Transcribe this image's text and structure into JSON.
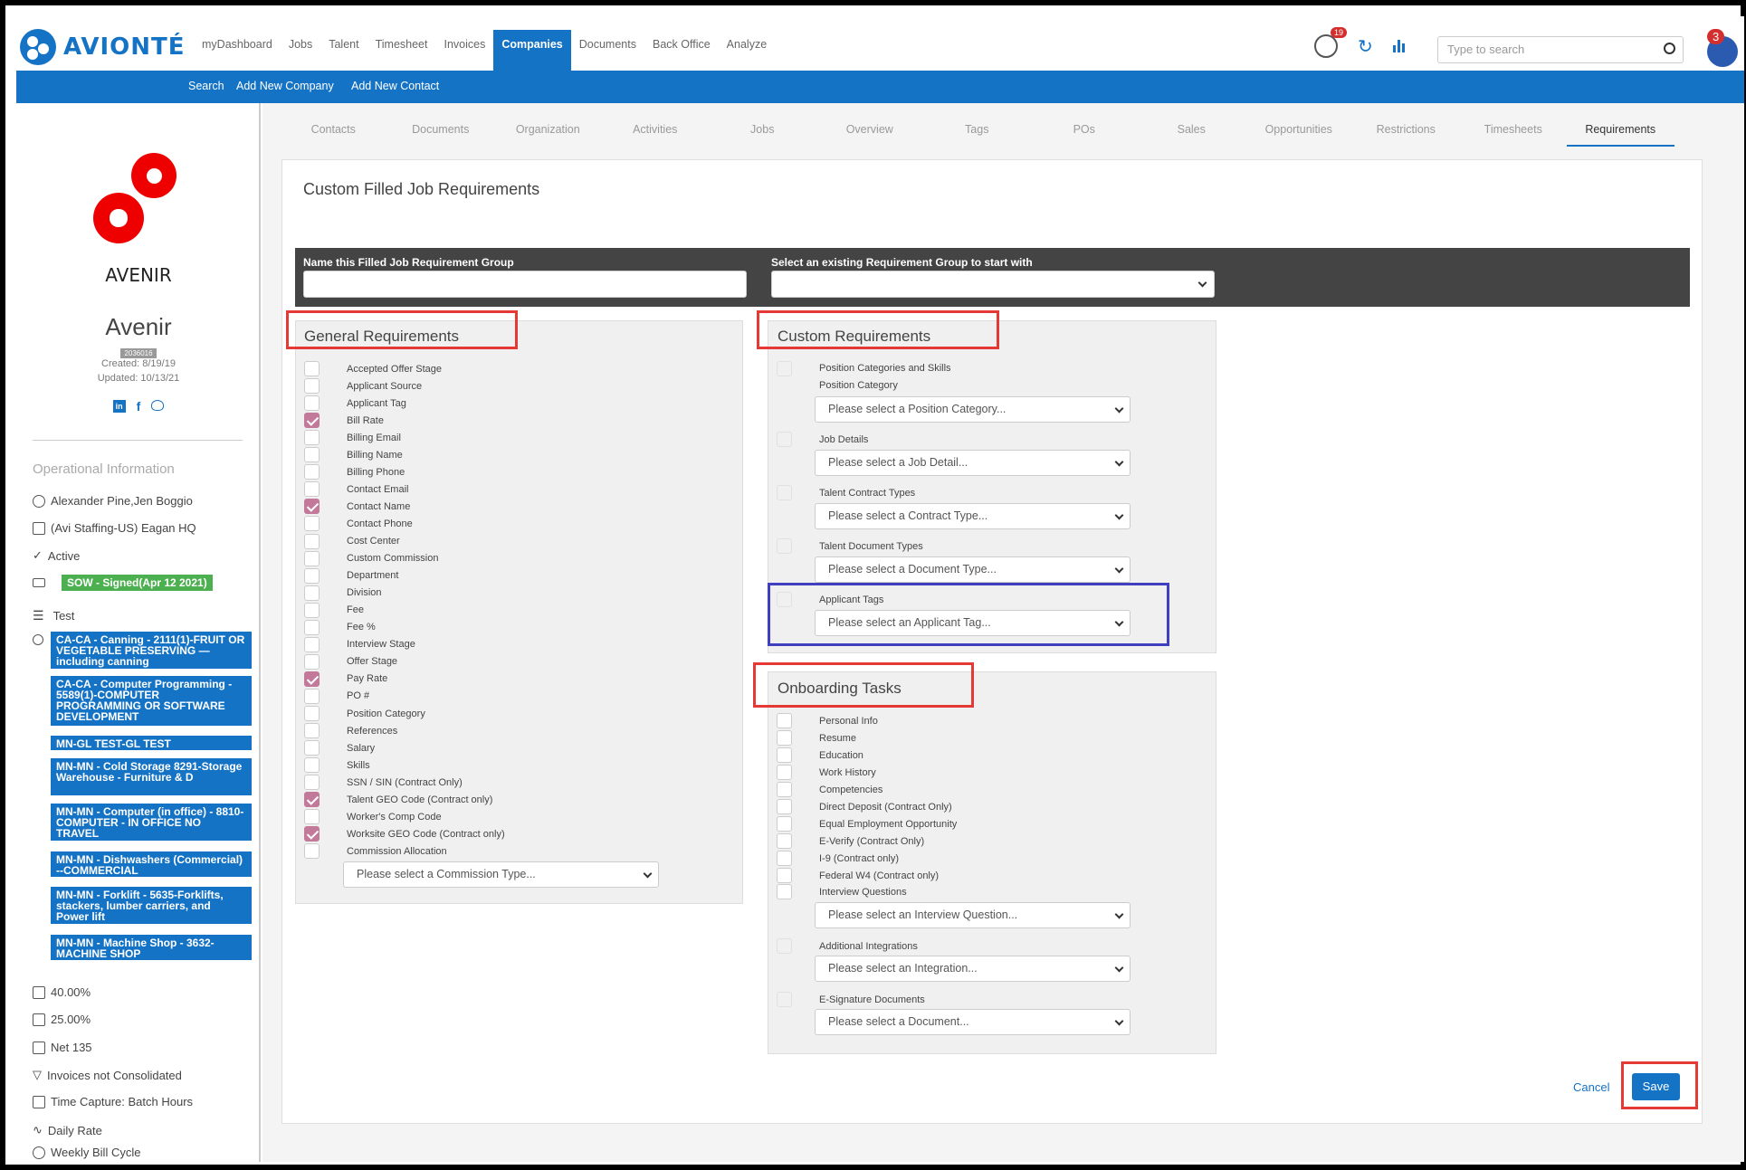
{
  "app": {
    "logo_text": "AVIONTÉ"
  },
  "main_nav": [
    "myDashboard",
    "Jobs",
    "Talent",
    "Timesheet",
    "Invoices",
    "Companies",
    "Documents",
    "Back Office",
    "Analyze"
  ],
  "main_nav_active": "Companies",
  "notifications_badge": "19",
  "avatar_badge": "3",
  "search": {
    "placeholder": "Type to search"
  },
  "sub_nav": {
    "search": "Search",
    "add_company": "Add New Company",
    "add_contact": "Add New Contact"
  },
  "company": {
    "logo_caption": "AVENIR",
    "name": "Avenir",
    "id": "2036016",
    "created": "Created: 8/19/19",
    "updated": "Updated: 10/13/21"
  },
  "operational": {
    "heading": "Operational Information",
    "reps": "Alexander Pine,Jen Boggio",
    "branch": "(Avi Staffing-US) Eagan HQ",
    "status": "Active",
    "sow": "SOW - Signed(Apr 12 2021)",
    "list_label": "Test",
    "comp_codes": [
      "CA-CA - Canning - 2111(1)-FRUIT OR VEGETABLE PRESERVING — including canning",
      "CA-CA - Computer Programming - 5589(1)-COMPUTER PROGRAMMING OR SOFTWARE DEVELOPMENT",
      "MN-GL TEST-GL TEST",
      "MN-MN - Cold Storage 8291-Storage Warehouse - Furniture & D",
      "MN-MN - Computer (in office) - 8810-COMPUTER - IN OFFICE NO TRAVEL",
      "MN-MN - Dishwashers (Commercial) --COMMERCIAL",
      "MN-MN - Forklift - 5635-Forklifts, stackers, lumber carriers, and Power lift",
      "MN-MN - Machine Shop - 3632-MACHINE SHOP"
    ],
    "markup1": "40.00%",
    "markup2": "25.00%",
    "terms": "Net 135",
    "invoices": "Invoices not Consolidated",
    "time_capture": "Time Capture: Batch Hours",
    "rate": "Daily Rate",
    "cycle": "Weekly Bill Cycle"
  },
  "tabs": [
    "Contacts",
    "Documents",
    "Organization",
    "Activities",
    "Jobs",
    "Overview",
    "Tags",
    "POs",
    "Sales",
    "Opportunities",
    "Restrictions",
    "Timesheets",
    "Requirements"
  ],
  "tabs_active": "Requirements",
  "page_title": "Custom Filled Job Requirements",
  "group_bar": {
    "name_label": "Name this Filled Job Requirement Group",
    "name_value": "",
    "existing_label": "Select an existing Requirement Group to start with",
    "existing_value": ""
  },
  "general": {
    "title": "General Requirements",
    "items": [
      {
        "label": "Accepted Offer Stage",
        "checked": false
      },
      {
        "label": "Applicant Source",
        "checked": false
      },
      {
        "label": "Applicant Tag",
        "checked": false
      },
      {
        "label": "Bill Rate",
        "checked": true
      },
      {
        "label": "Billing Email",
        "checked": false
      },
      {
        "label": "Billing Name",
        "checked": false
      },
      {
        "label": "Billing Phone",
        "checked": false
      },
      {
        "label": "Contact Email",
        "checked": false
      },
      {
        "label": "Contact Name",
        "checked": true
      },
      {
        "label": "Contact Phone",
        "checked": false
      },
      {
        "label": "Cost Center",
        "checked": false
      },
      {
        "label": "Custom Commission",
        "checked": false
      },
      {
        "label": "Department",
        "checked": false
      },
      {
        "label": "Division",
        "checked": false
      },
      {
        "label": "Fee",
        "checked": false
      },
      {
        "label": "Fee %",
        "checked": false
      },
      {
        "label": "Interview Stage",
        "checked": false
      },
      {
        "label": "Offer Stage",
        "checked": false
      },
      {
        "label": "Pay Rate",
        "checked": true
      },
      {
        "label": "PO #",
        "checked": false
      },
      {
        "label": "Position Category",
        "checked": false
      },
      {
        "label": "References",
        "checked": false
      },
      {
        "label": "Salary",
        "checked": false
      },
      {
        "label": "Skills",
        "checked": false
      },
      {
        "label": "SSN / SIN (Contract Only)",
        "checked": false
      },
      {
        "label": "Talent GEO Code (Contract only)",
        "checked": true
      },
      {
        "label": "Worker's Comp Code",
        "checked": false
      },
      {
        "label": "Worksite GEO Code (Contract only)",
        "checked": true
      },
      {
        "label": "Commission Allocation",
        "checked": false
      }
    ],
    "commission_select": "Please select a Commission Type..."
  },
  "custom": {
    "title": "Custom Requirements",
    "pos_cat_label": "Position Categories and Skills",
    "pos_cat_sub": "Position Category",
    "pos_cat_select": "Please select a Position Category...",
    "job_details_label": "Job Details",
    "job_details_select": "Please select a Job Detail...",
    "contract_label": "Talent Contract Types",
    "contract_select": "Please select a Contract Type...",
    "doc_label": "Talent Document Types",
    "doc_select": "Please select a Document Type...",
    "tags_label": "Applicant Tags",
    "tags_select": "Please select an Applicant Tag..."
  },
  "onboarding": {
    "title": "Onboarding Tasks",
    "items": [
      "Personal Info",
      "Resume",
      "Education",
      "Work History",
      "Competencies",
      "Direct Deposit (Contract Only)",
      "Equal Employment Opportunity",
      "E-Verify (Contract Only)",
      "I-9 (Contract only)",
      "Federal W4 (Contract only)"
    ],
    "interview_label": "Interview Questions",
    "interview_select": "Please select an Interview Question...",
    "integrations_label": "Additional Integrations",
    "integrations_select": "Please select an Integration...",
    "esign_label": "E-Signature Documents",
    "esign_select": "Please select a Document..."
  },
  "actions": {
    "cancel": "Cancel",
    "save": "Save"
  },
  "colors": {
    "brand_blue": "#1573c6",
    "check_pink": "#c37a9a",
    "highlight_red": "#e53935",
    "highlight_blue": "#3f3fbf",
    "sow_green": "#4caf50"
  }
}
